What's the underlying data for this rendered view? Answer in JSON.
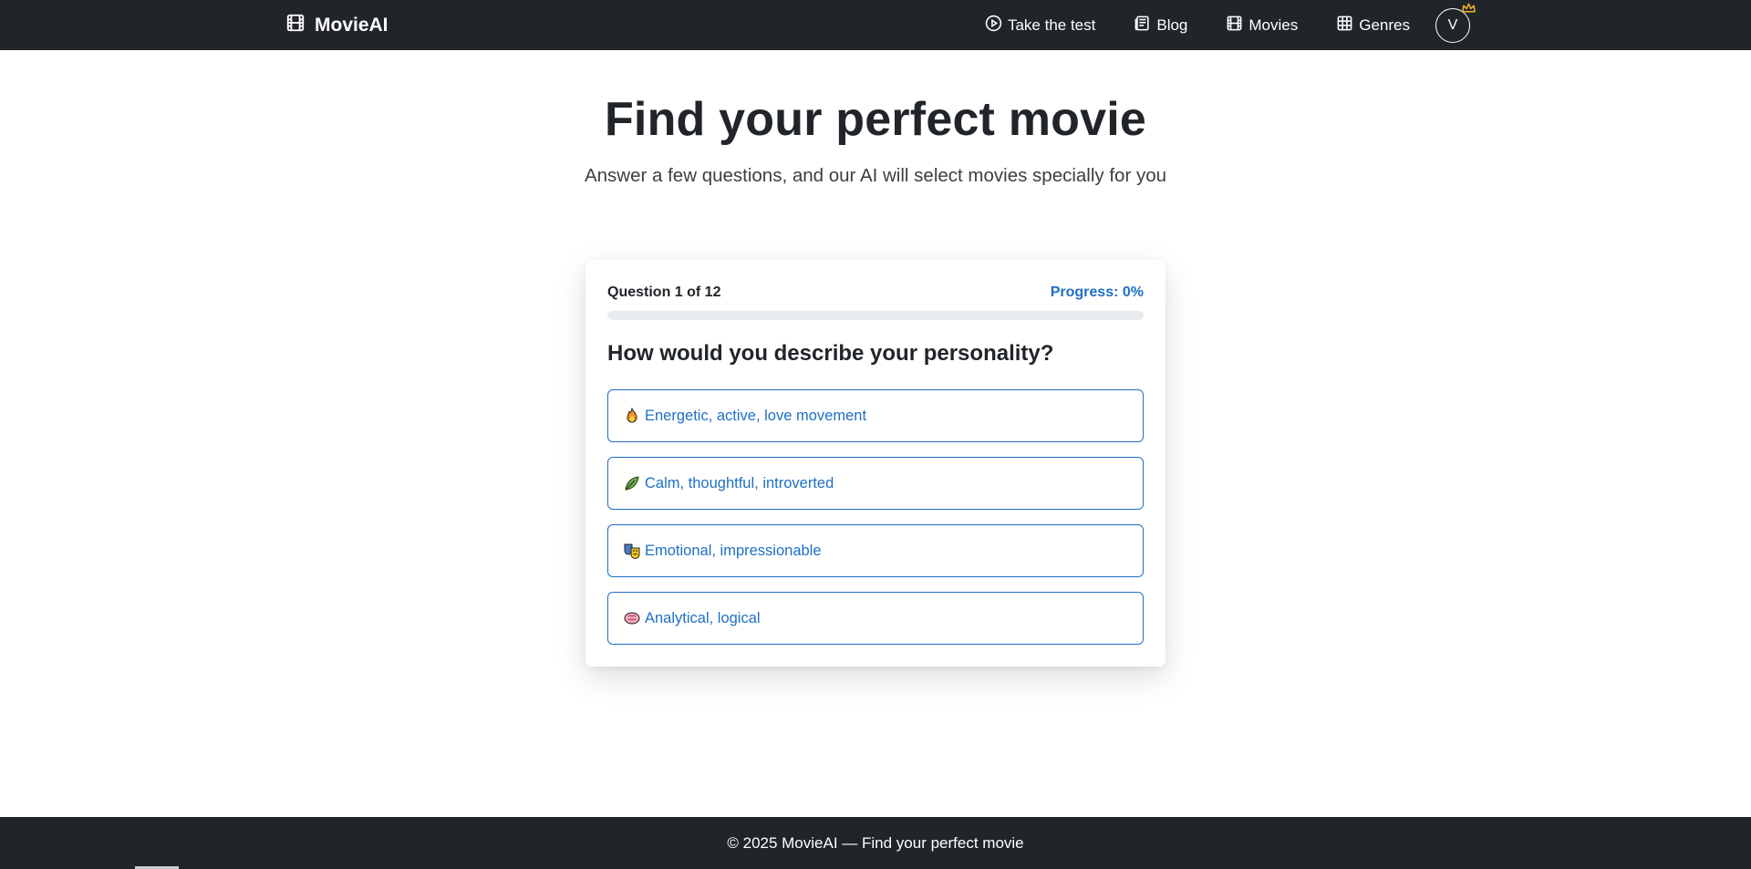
{
  "navbar": {
    "brand": "MovieAI",
    "links": [
      {
        "label": "Take the test",
        "icon": "play-circle-icon"
      },
      {
        "label": "Blog",
        "icon": "newspaper-icon"
      },
      {
        "label": "Movies",
        "icon": "film-icon"
      },
      {
        "label": "Genres",
        "icon": "grid-icon"
      }
    ],
    "avatar_initial": "V",
    "avatar_badge_icon": "crown-icon"
  },
  "hero": {
    "title": "Find your perfect movie",
    "subtitle": "Answer a few questions, and our AI will select movies specially for you"
  },
  "quiz": {
    "counter": "Question 1 of 12",
    "progress_label": "Progress: 0%",
    "progress_value": 0,
    "question": "How would you describe your personality?",
    "options": [
      {
        "emoji": "fire-icon",
        "label": "Energetic, active, love movement"
      },
      {
        "emoji": "leaf-icon",
        "label": "Calm, thoughtful, introverted"
      },
      {
        "emoji": "theater-masks-icon",
        "label": "Emotional, impressionable"
      },
      {
        "emoji": "brain-icon",
        "label": "Analytical, logical"
      }
    ]
  },
  "footer": {
    "text": "© 2025 MovieAI — Find your perfect movie"
  },
  "colors": {
    "navbar_bg": "#212529",
    "accent": "#1f6fc5",
    "crown": "#f0b429"
  }
}
